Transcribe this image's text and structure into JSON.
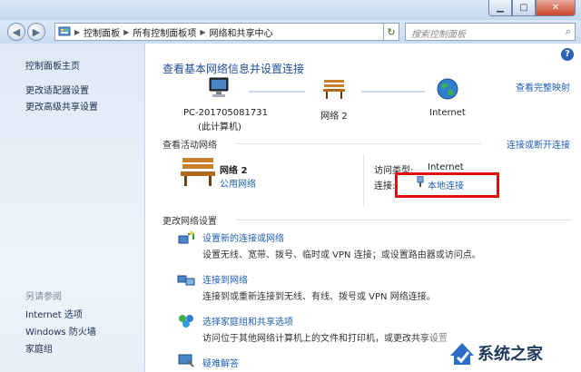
{
  "window": {
    "min_icon": "minimize-icon",
    "max_icon": "maximize-icon",
    "close_icon": "close-icon"
  },
  "nav": {
    "back_icon": "back-arrow-icon",
    "forward_icon": "forward-arrow-icon",
    "breadcrumbs": [
      "控制面板",
      "所有控制面板项",
      "网络和共享中心"
    ],
    "search_placeholder": "搜索控制面板"
  },
  "sidebar": {
    "items": [
      "控制面板主页",
      "更改适配器设置",
      "更改高级共享设置"
    ],
    "see_also_label": "另请参阅",
    "see_also": [
      "Internet 选项",
      "Windows 防火墙",
      "家庭组"
    ]
  },
  "main": {
    "title": "查看基本网络信息并设置连接",
    "view_full_map": "查看完整映射",
    "map": {
      "computer_name": "PC-201705081731",
      "computer_sub": "(此计算机)",
      "network_name": "网络  2",
      "internet": "Internet"
    },
    "active_header": "查看活动网络",
    "connect_disconnect": "连接或断开连接",
    "active_network": {
      "name": "网络  2",
      "type": "公用网络",
      "access_type_label": "访问类型:",
      "access_type_value": "Internet",
      "connection_label": "连接:",
      "connection_value": "本地连接"
    },
    "change_header": "更改网络设置",
    "tasks": [
      {
        "title": "设置新的连接或网络",
        "desc": "设置无线、宽带、拨号、临时或 VPN 连接；或设置路由器或访问点。"
      },
      {
        "title": "连接到网络",
        "desc": "连接到或重新连接到无线、有线、拨号或 VPN 网络连接。"
      },
      {
        "title": "选择家庭组和共享选项",
        "desc": "访问位于其他网络计算机上的文件和打印机，或更改共享设置"
      },
      {
        "title": "疑难解答",
        "desc": ""
      }
    ]
  },
  "watermark": "系统之家",
  "colors": {
    "link": "#1f5fb0",
    "highlight_box": "#e01010"
  }
}
